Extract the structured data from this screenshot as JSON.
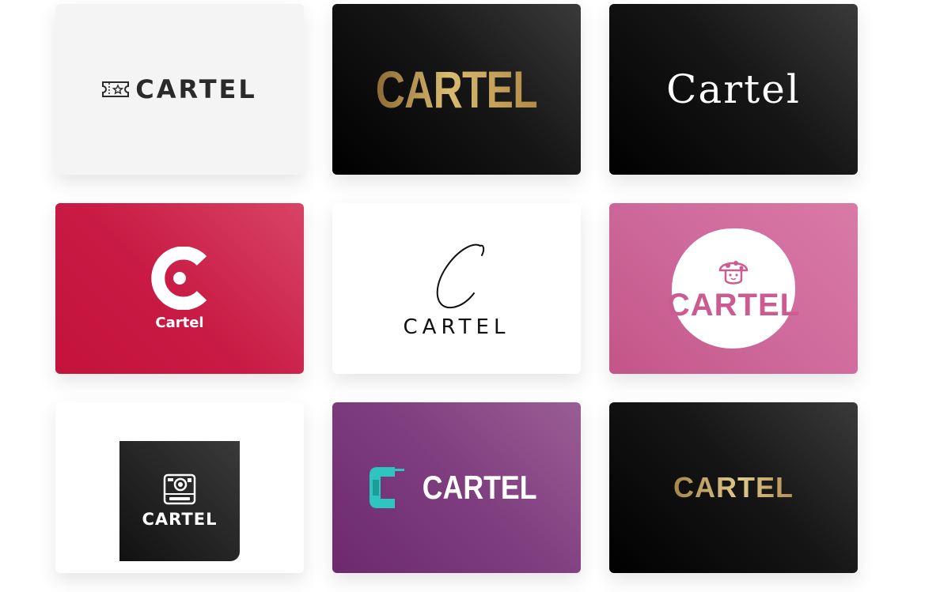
{
  "cards": [
    {
      "name": "CARTEL"
    },
    {
      "name": "CARTEL"
    },
    {
      "name": "Cartel"
    },
    {
      "name": "Cartel"
    },
    {
      "name": "CARTEL"
    },
    {
      "name": "CARTEL"
    },
    {
      "name": "CARTEL"
    },
    {
      "name": "CARTEL"
    },
    {
      "name": "CARTEL"
    }
  ],
  "colors": {
    "crimson": "#c81a44",
    "pink": "#cf6a9c",
    "purple": "#7e3d7e",
    "gold": "#c9a45a",
    "teal": "#2ec4bf"
  }
}
